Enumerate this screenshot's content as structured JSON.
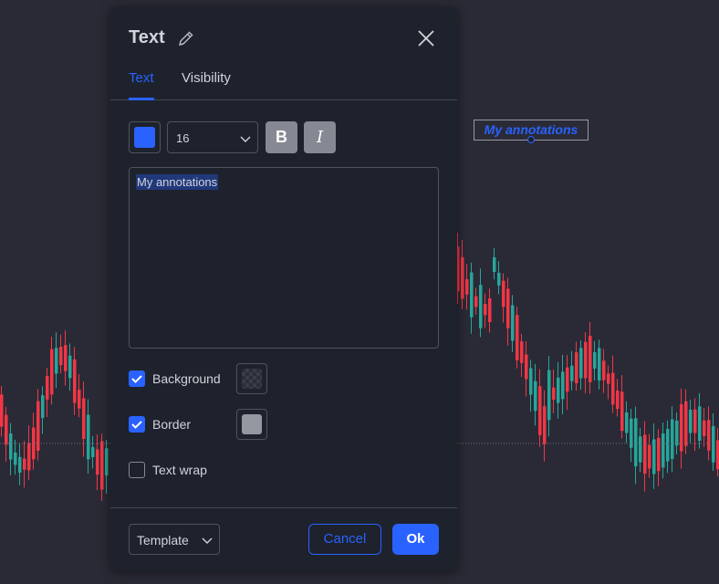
{
  "chart_canvas": {
    "colors": {
      "up": "#26a69a",
      "down": "#f23645",
      "background": "#2a2a36"
    }
  },
  "chart_annotation": {
    "text": "My annotations",
    "color": "#2962ff"
  },
  "dialog": {
    "title": "Text",
    "tabs": [
      {
        "label": "Text",
        "active": true
      },
      {
        "label": "Visibility",
        "active": false
      }
    ],
    "style": {
      "text_color": "#2962ff",
      "font_size": "16",
      "bold": true,
      "italic": true
    },
    "text_value": "My annotations",
    "options": {
      "background": {
        "label": "Background",
        "checked": true
      },
      "border": {
        "label": "Border",
        "checked": true,
        "color": "#9598a1"
      },
      "text_wrap": {
        "label": "Text wrap",
        "checked": false
      }
    },
    "footer": {
      "template_label": "Template",
      "cancel_label": "Cancel",
      "ok_label": "Ok"
    },
    "icons": {
      "rename": "pencil-icon",
      "close": "close-icon",
      "dropdown": "chevron-down-icon",
      "check": "check-icon"
    }
  }
}
